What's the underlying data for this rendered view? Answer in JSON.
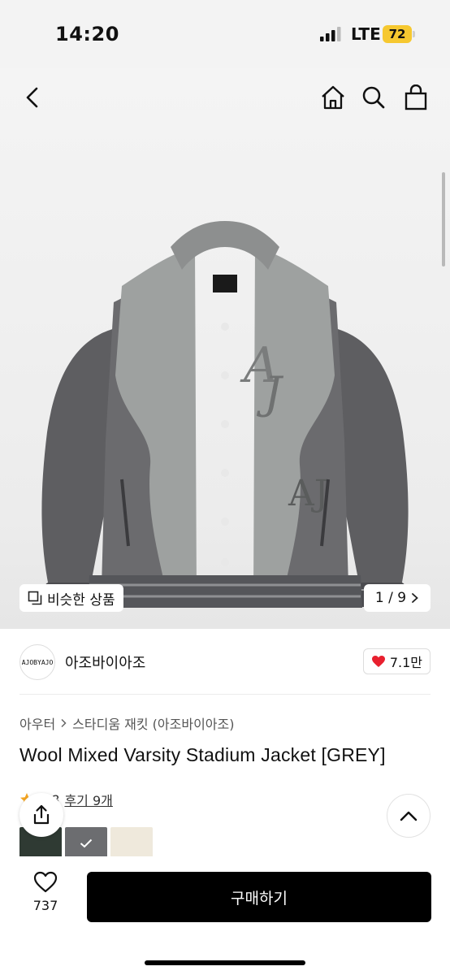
{
  "status_bar": {
    "time": "14:20",
    "network": "LTE",
    "battery": "72"
  },
  "nav": {
    "back_icon": "chevron-left-icon",
    "home_icon": "home-icon",
    "search_icon": "search-icon",
    "cart_icon": "shopping-bag-icon"
  },
  "gallery": {
    "similar_label": "비슷한 상품",
    "page_indicator": "1 / 9"
  },
  "brand": {
    "logo_text": "AJOBYAJO",
    "name": "아조바이아조",
    "likes": "7.1만"
  },
  "product": {
    "category": "아우터",
    "subcategory": "스타디움 재킷 (아조바이아조)",
    "title": "Wool Mixed Varsity Stadium Jacket [GREY]",
    "rating": "4.8",
    "reviews": "후기 9개"
  },
  "bottom": {
    "wish_count": "737",
    "buy_label": "구매하기"
  },
  "colors": {
    "accent": "#000000",
    "heart": "#e8202f",
    "star": "#f5a623",
    "battery": "#f6c830"
  }
}
